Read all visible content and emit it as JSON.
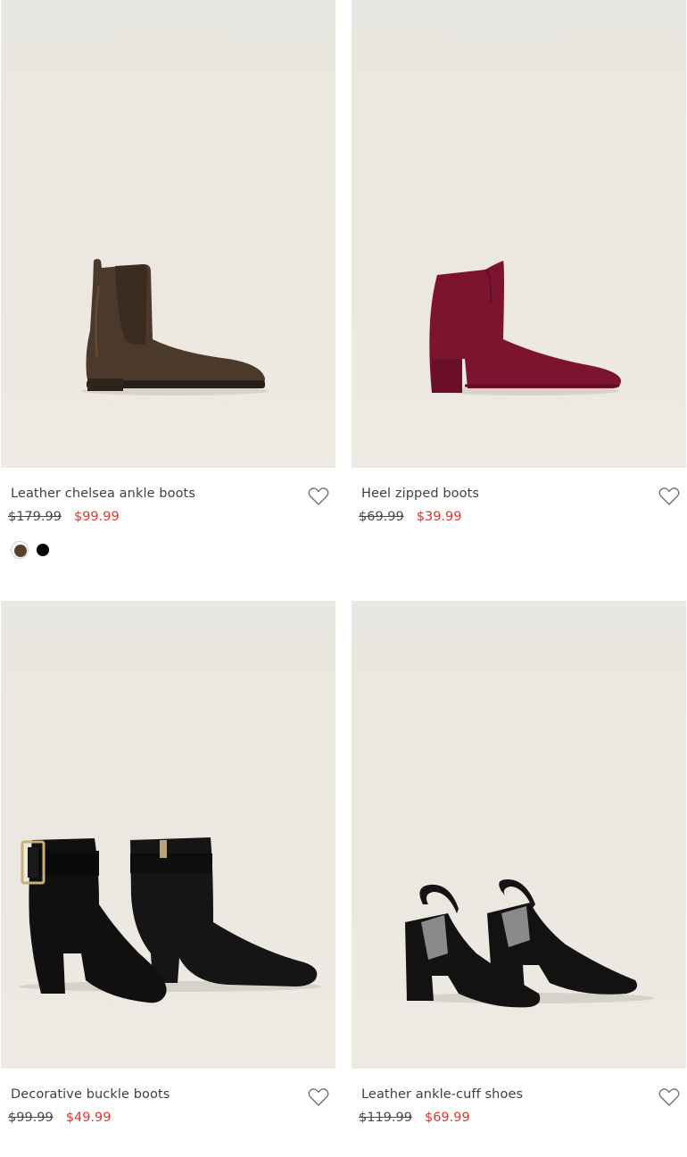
{
  "products": [
    {
      "name": "Leather chelsea ankle boots",
      "old_price": "$179.99",
      "new_price": "$99.99",
      "image_alt": "brown leather chelsea ankle boot",
      "colors": [
        "#5a4030",
        "#000000"
      ]
    },
    {
      "name": "Heel zipped boots",
      "old_price": "$69.99",
      "new_price": "$39.99",
      "image_alt": "burgundy suede heeled ankle boot",
      "colors": []
    },
    {
      "name": "Decorative buckle boots",
      "old_price": "$99.99",
      "new_price": "$49.99",
      "image_alt": "pair of black suede buckle boots",
      "colors": []
    },
    {
      "name": "Leather ankle-cuff shoes",
      "old_price": "$119.99",
      "new_price": "$69.99",
      "image_alt": "pair of black ankle-cuff heels",
      "colors": []
    }
  ],
  "icons": {
    "wishlist": "heart-outline-icon"
  },
  "theme": {
    "sale_color": "#e0352f",
    "text_color": "#3f3f3f",
    "image_bg": "#ece8e1"
  }
}
